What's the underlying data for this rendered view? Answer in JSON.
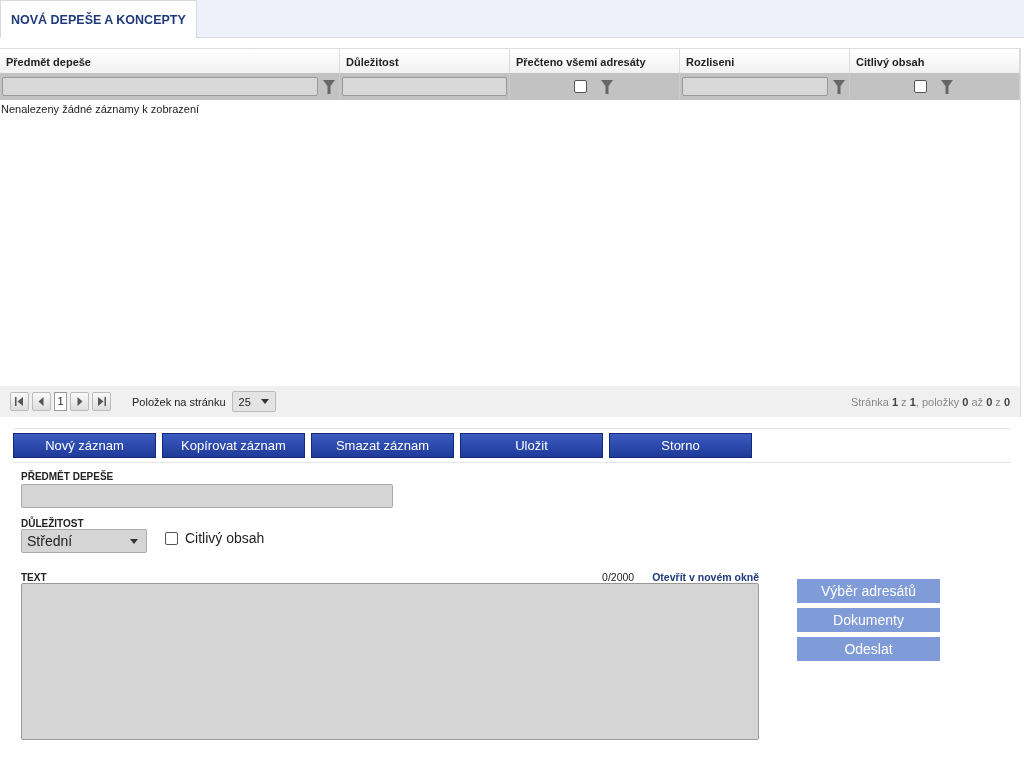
{
  "tabs": [
    {
      "label": "NOVÁ DEPEŠE A KONCEPTY",
      "selected": true
    }
  ],
  "table": {
    "columns": [
      {
        "label": "Předmět depeše",
        "filter": {
          "kind": "text",
          "funnel": true
        }
      },
      {
        "label": "Důležitost",
        "filter": {
          "kind": "text",
          "funnel": false
        }
      },
      {
        "label": "Přečteno všemi adresáty",
        "filter": {
          "kind": "checkbox",
          "checked": false,
          "funnel": true
        }
      },
      {
        "label": "Rozliseni",
        "filter": {
          "kind": "text",
          "funnel": true
        }
      },
      {
        "label": "Citlivý obsah",
        "filter": {
          "kind": "checkbox",
          "checked": false,
          "funnel": true
        }
      }
    ],
    "empty_message": "Nenalezeny žádné záznamy k zobrazení"
  },
  "pager": {
    "page": "1",
    "per_page_label": "Položek na stránku",
    "per_page": "25",
    "summary": "Stránka **1** z **1**, položky **0** až **0** z **0**"
  },
  "actions": [
    "Nový záznam",
    "Kopírovat záznam",
    "Smazat záznam",
    "Uložit",
    "Storno"
  ],
  "form": {
    "subject_label": "PŘEDMĚT DEPEŠE",
    "importance_label": "DŮLEŽITOST",
    "importance": "Střední",
    "sensitive": {
      "label": "Citlivý obsah",
      "checked": false
    },
    "text_label": "TEXT",
    "counter": "0/2000",
    "open_link": "Otevřít v novém okně",
    "side_buttons": [
      {
        "label": "Výběr adresátů",
        "disabled": true
      },
      {
        "label": "Dokumenty",
        "disabled": true
      },
      {
        "label": "Odeslat",
        "disabled": true
      }
    ]
  }
}
